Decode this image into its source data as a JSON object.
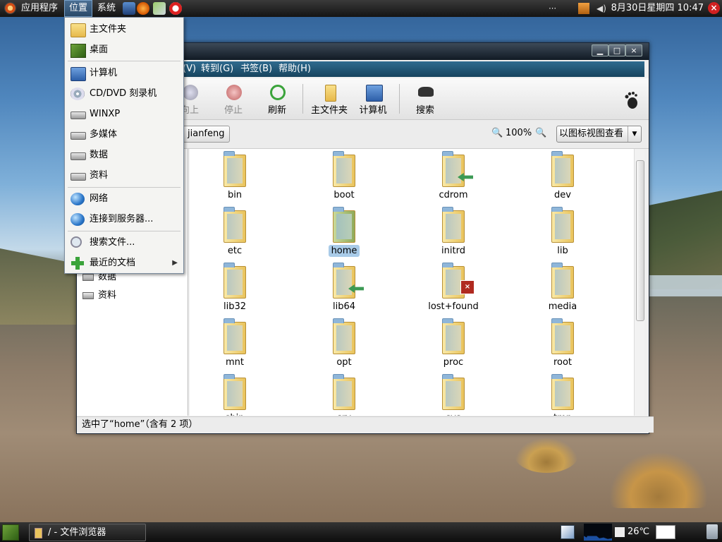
{
  "top_panel": {
    "menus": [
      "应用程序",
      "位置",
      "系统"
    ],
    "active_menu": "位置",
    "clock": "8月30日星期四 10:47"
  },
  "places_menu": {
    "items": [
      {
        "label": "主文件夹",
        "icon": "home-folder-icon"
      },
      {
        "label": "桌面",
        "icon": "desktop-icon"
      },
      {
        "label": "计算机",
        "icon": "computer-icon"
      },
      {
        "label": "CD/DVD 刻录机",
        "icon": "cd-burner-icon"
      },
      {
        "label": "WINXP",
        "icon": "drive-icon"
      },
      {
        "label": "多媒体",
        "icon": "drive-icon"
      },
      {
        "label": "数据",
        "icon": "drive-icon"
      },
      {
        "label": "资料",
        "icon": "drive-icon"
      },
      {
        "label": "网络",
        "icon": "network-icon"
      },
      {
        "label": "连接到服务器...",
        "icon": "globe-icon"
      },
      {
        "label": "搜索文件...",
        "icon": "search-icon"
      },
      {
        "label": "最近的文档",
        "icon": "recent-documents-icon",
        "submenu": true
      }
    ]
  },
  "window": {
    "menubar": [
      "(V)",
      "转到(G)",
      "书签(B)",
      "帮助(H)"
    ],
    "toolbar": {
      "up": "向上",
      "stop": "停止",
      "reload": "刷新",
      "home": "主文件夹",
      "computer": "计算机",
      "search": "搜索"
    },
    "location": {
      "path_button": "jianfeng",
      "zoom": "100%",
      "view_mode": "以图标视图查看"
    },
    "sidebar": {
      "items": [
        "数据",
        "资料"
      ]
    },
    "files": [
      {
        "name": "bin"
      },
      {
        "name": "boot"
      },
      {
        "name": "cdrom",
        "emblem": "link"
      },
      {
        "name": "dev"
      },
      {
        "name": "etc"
      },
      {
        "name": "home",
        "selected": true
      },
      {
        "name": "initrd"
      },
      {
        "name": "lib"
      },
      {
        "name": "lib32"
      },
      {
        "name": "lib64",
        "emblem": "link"
      },
      {
        "name": "lost+found",
        "emblem": "unreadable"
      },
      {
        "name": "media"
      },
      {
        "name": "mnt"
      },
      {
        "name": "opt"
      },
      {
        "name": "proc"
      },
      {
        "name": "root"
      },
      {
        "name": "sbin"
      },
      {
        "name": "srv"
      },
      {
        "name": "sys"
      },
      {
        "name": "tmp"
      }
    ],
    "status": "选中了“home”（含有 2 项）"
  },
  "bottom_panel": {
    "task_title": "/ - 文件浏览器",
    "temperature": "26℃"
  },
  "colors": {
    "menubar": "#1f5575",
    "selection": "#a9cbe8",
    "panel": "#1a1a1a"
  }
}
